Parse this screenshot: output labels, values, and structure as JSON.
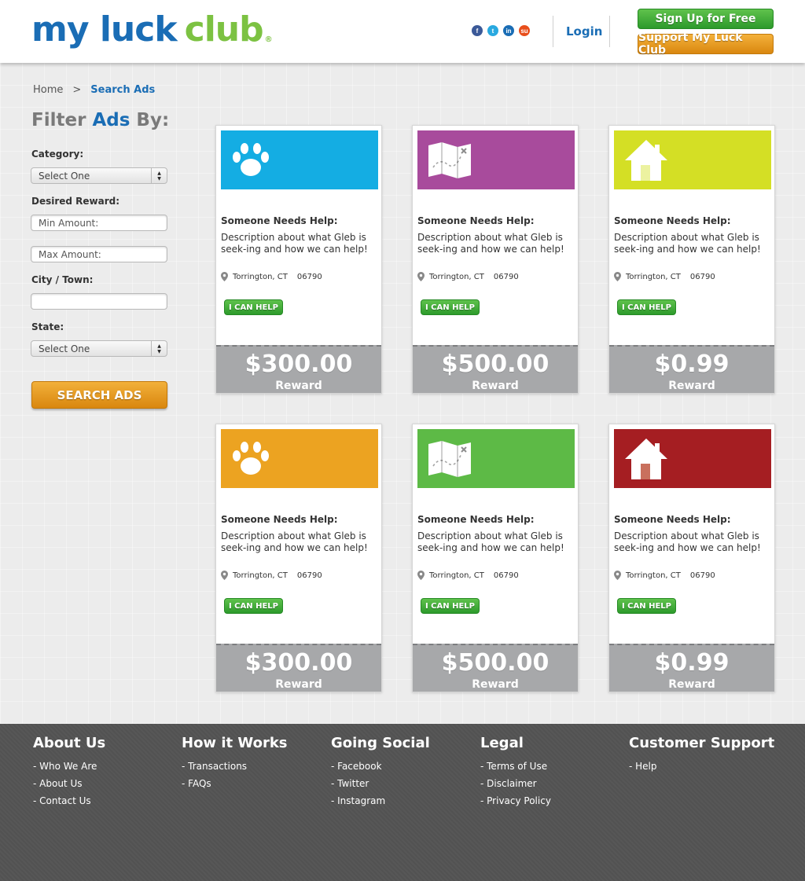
{
  "header": {
    "logo_part1": "my luck",
    "logo_part2": "club",
    "logo_mark": "®",
    "social": [
      {
        "icon": "facebook-icon",
        "glyph": "f"
      },
      {
        "icon": "twitter-icon",
        "glyph": "t"
      },
      {
        "icon": "linkedin-icon",
        "glyph": "in"
      },
      {
        "icon": "stumbleupon-icon",
        "glyph": "su"
      }
    ],
    "login_label": "Login",
    "signup_label": "Sign Up for Free",
    "support_label": "Support My Luck Club"
  },
  "breadcrumb": {
    "home": "Home",
    "separator": ">",
    "current": "Search Ads"
  },
  "filter": {
    "title_a": "Filter",
    "title_b": "Ads",
    "title_c": "By:",
    "category_label": "Category:",
    "category_value": "Select One",
    "reward_label": "Desired Reward:",
    "min_placeholder": "Min Amount:",
    "max_placeholder": "Max Amount:",
    "city_label": "City / Town:",
    "city_value": "",
    "state_label": "State:",
    "state_value": "Select One",
    "search_label": "SEARCH ADS"
  },
  "cards": [
    {
      "icon": "paw-icon",
      "color": "#14ade3",
      "heading": "Someone Needs Help:",
      "description": "Description about what Gleb is seek-ing and how we can help!",
      "city": "Torrington, CT",
      "zip": "06790",
      "button": "I CAN HELP",
      "amount": "$300.00",
      "reward_label": "Reward"
    },
    {
      "icon": "map-icon",
      "color": "#a84b9c",
      "heading": "Someone Needs Help:",
      "description": "Description about what Gleb is seek-ing and how we can help!",
      "city": "Torrington, CT",
      "zip": "06790",
      "button": "I CAN HELP",
      "amount": "$500.00",
      "reward_label": "Reward"
    },
    {
      "icon": "house-icon",
      "color": "#d4df25",
      "heading": "Someone Needs Help:",
      "description": "Description about what Gleb is seek-ing and how we can help!",
      "city": "Torrington, CT",
      "zip": "06790",
      "button": "I CAN HELP",
      "amount": "$0.99",
      "reward_label": "Reward"
    },
    {
      "icon": "paw-icon",
      "color": "#eca321",
      "heading": "Someone Needs Help:",
      "description": "Description about what Gleb is seek-ing and how we can help!",
      "city": "Torrington, CT",
      "zip": "06790",
      "button": "I CAN HELP",
      "amount": "$300.00",
      "reward_label": "Reward"
    },
    {
      "icon": "map-icon",
      "color": "#5dba46",
      "heading": "Someone Needs Help:",
      "description": "Description about what Gleb is seek-ing and how we can help!",
      "city": "Torrington, CT",
      "zip": "06790",
      "button": "I CAN HELP",
      "amount": "$500.00",
      "reward_label": "Reward"
    },
    {
      "icon": "house-icon",
      "color": "#a51e22",
      "heading": "Someone Needs Help:",
      "description": "Description about what Gleb is seek-ing and how we can help!",
      "city": "Torrington, CT",
      "zip": "06790",
      "button": "I CAN HELP",
      "amount": "$0.99",
      "reward_label": "Reward"
    }
  ],
  "footer": {
    "columns": [
      {
        "title": "About Us",
        "links": [
          "- Who We Are",
          "- About Us",
          "- Contact Us"
        ]
      },
      {
        "title": "How it Works",
        "links": [
          "- Transactions",
          "- FAQs"
        ]
      },
      {
        "title": "Going Social",
        "links": [
          "- Facebook",
          "- Twitter",
          "- Instagram"
        ]
      },
      {
        "title": "Legal",
        "links": [
          "- Terms of Use",
          "- Disclaimer",
          "- Privacy Policy"
        ]
      },
      {
        "title": "Customer Support",
        "links": [
          "- Help"
        ]
      }
    ]
  },
  "colors": {
    "brand_blue": "#1a6db5",
    "brand_green": "#7cc242",
    "button_green": "#2d9a2c",
    "button_orange": "#d9870f",
    "reward_gray": "#a7a8aa",
    "footer_bg": "#575757"
  }
}
